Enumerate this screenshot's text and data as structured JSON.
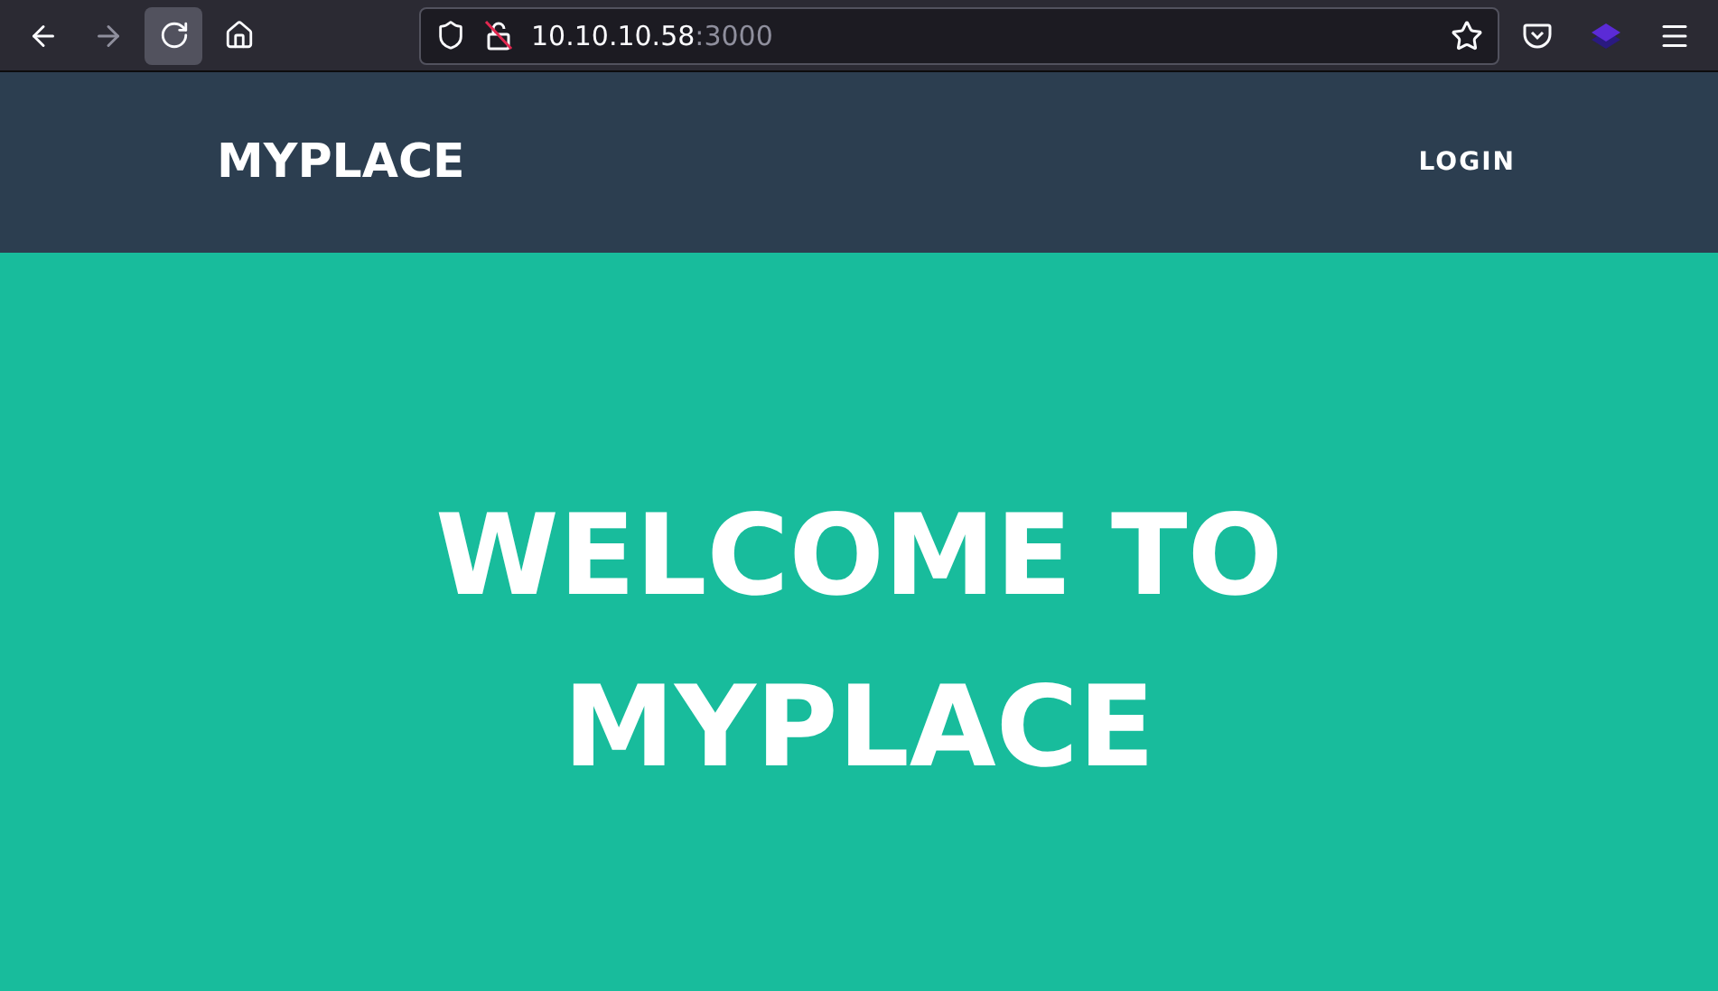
{
  "browser": {
    "back": {
      "disabled": false
    },
    "forward": {
      "disabled": true
    },
    "address": {
      "host": "10.10.10.58",
      "port": ":3000"
    }
  },
  "navbar": {
    "brand": "MYPLACE",
    "links": [
      "LOGIN"
    ]
  },
  "hero": {
    "title": "WELCOME TO MYPLACE"
  }
}
